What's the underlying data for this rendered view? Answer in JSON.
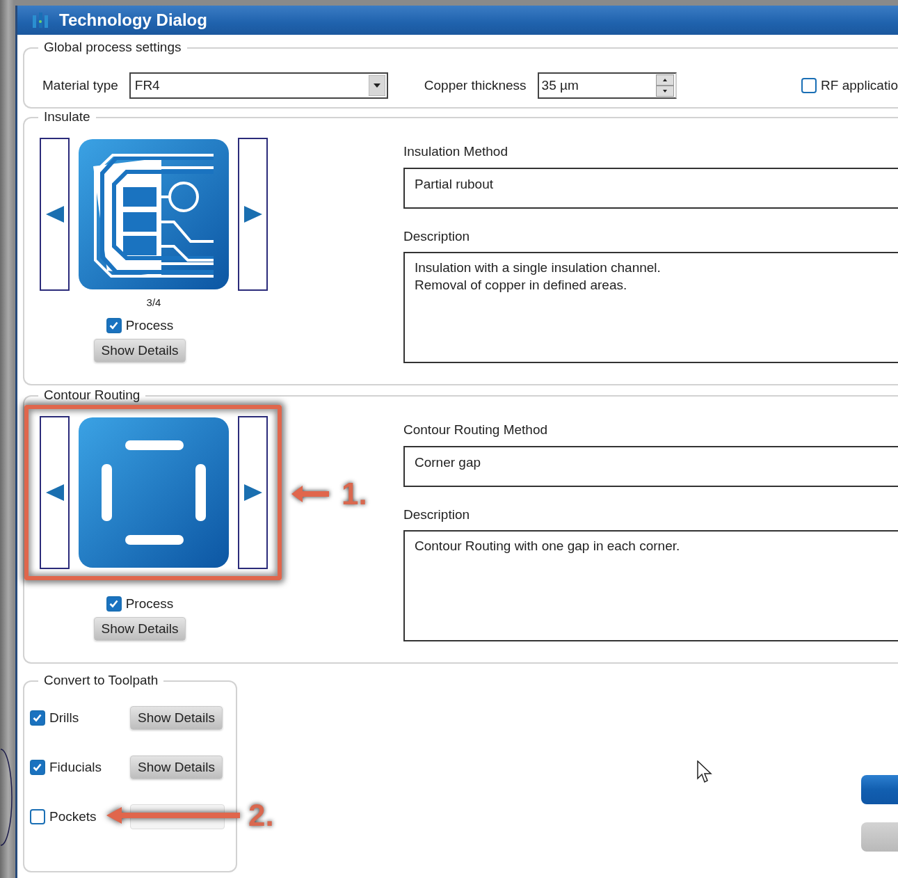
{
  "window": {
    "title": "Technology Dialog"
  },
  "global_settings": {
    "title": "Global process settings",
    "material_label": "Material type",
    "material_value": "FR4",
    "copper_label": "Copper thickness",
    "copper_value": "35 µm",
    "rf": {
      "label": "RF applicatio",
      "checked": false
    }
  },
  "processes": [
    {
      "title": "Insulate",
      "kind": "insulate",
      "counter": "3/4",
      "process": {
        "label": "Process",
        "checked": true
      },
      "details_button": "Show Details",
      "method_label": "Insulation Method",
      "method": "Partial rubout",
      "description_label": "Description",
      "description": "Insulation with a single insulation channel.\nRemoval of copper in defined areas."
    },
    {
      "title": "Contour Routing",
      "kind": "contour",
      "callout": "1.",
      "process": {
        "label": "Process",
        "checked": true
      },
      "details_button": "Show Details",
      "method_label": "Contour Routing Method",
      "method": "Corner gap",
      "description_label": "Description",
      "description": "Contour Routing with one gap in each corner."
    }
  ],
  "toolpath": {
    "title": "Convert to Toolpath",
    "items": [
      {
        "label": "Drills",
        "checked": true,
        "button": "Show Details"
      },
      {
        "label": "Fiducials",
        "checked": true,
        "button": "Show Details"
      },
      {
        "label": "Pockets",
        "checked": false,
        "button_disabled": true,
        "callout": "2."
      }
    ]
  }
}
